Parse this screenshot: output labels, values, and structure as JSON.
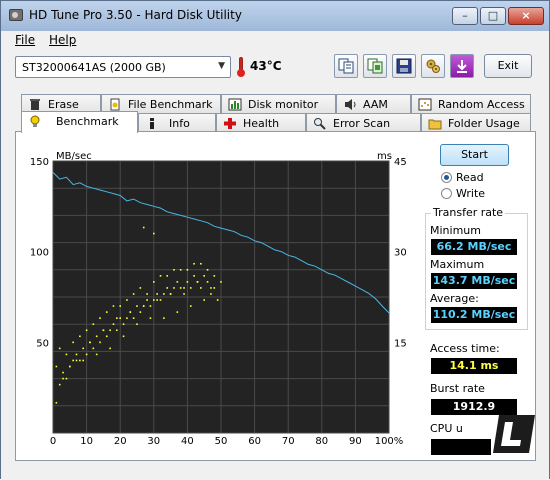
{
  "window": {
    "title": "HD Tune Pro 3.50 - Hard Disk Utility",
    "minimize_label": "–",
    "maximize_label": "□",
    "close_label": "×"
  },
  "menu": {
    "file": "File",
    "help": "Help"
  },
  "toolbar": {
    "drive": "ST32000641AS (2000 GB)",
    "temperature": "43°C",
    "exit_label": "Exit",
    "icons": [
      "copy-info-icon",
      "copy-screenshot-icon",
      "save-icon",
      "options-icon",
      "download-icon"
    ]
  },
  "tabs_row1": [
    "Erase",
    "File Benchmark",
    "Disk monitor",
    "AAM",
    "Random Access"
  ],
  "tabs_row2": [
    "Benchmark",
    "Info",
    "Health",
    "Error Scan",
    "Folder Usage"
  ],
  "active_tab": "Benchmark",
  "controls": {
    "start_label": "Start",
    "read_label": "Read",
    "write_label": "Write",
    "selected_mode": "Read"
  },
  "results": {
    "transfer_rate_title": "Transfer rate",
    "minimum_label": "Minimum",
    "minimum_value": "66.2 MB/sec",
    "maximum_label": "Maximum",
    "maximum_value": "143.7 MB/sec",
    "average_label": "Average:",
    "average_value": "110.2 MB/sec",
    "access_time_label": "Access time:",
    "access_time_value": "14.1 ms",
    "burst_rate_label": "Burst rate",
    "burst_rate_value": "1912.9 MB/sec",
    "cpu_label": "CPU u",
    "cpu_value": ""
  },
  "chart_data": {
    "type": "line",
    "left_axis_label": "MB/sec",
    "right_axis_label": "ms",
    "y_ticks_left": [
      "150",
      "100",
      "50"
    ],
    "y_ticks_right": [
      "45",
      "30",
      "15"
    ],
    "x_ticks": [
      "0",
      "10",
      "20",
      "30",
      "40",
      "50",
      "60",
      "70",
      "80",
      "90",
      "100%"
    ],
    "ylim_left": [
      0,
      150
    ],
    "ylim_right": [
      0,
      45
    ],
    "xlim": [
      0,
      100
    ],
    "colors": {
      "background": "#232323",
      "grid": "#4a4a4a",
      "transfer_line": "#48b7e8",
      "access_points": "#ffff33"
    },
    "series": [
      {
        "kind": "transfer",
        "x": [
          0,
          2,
          4,
          6,
          8,
          10,
          12,
          14,
          16,
          18,
          20,
          22,
          24,
          26,
          28,
          30,
          32,
          34,
          36,
          38,
          40,
          42,
          44,
          46,
          48,
          50,
          52,
          54,
          56,
          58,
          60,
          62,
          64,
          66,
          68,
          70,
          72,
          74,
          76,
          78,
          80,
          82,
          84,
          86,
          88,
          90,
          92,
          94,
          96,
          98,
          100
        ],
        "y": [
          143.7,
          140,
          141,
          137,
          138,
          136,
          135,
          134,
          133,
          132,
          131,
          128,
          129,
          127,
          126,
          125,
          124,
          122,
          121,
          120,
          119,
          118,
          117,
          116,
          114,
          113,
          112,
          111,
          109,
          108,
          106,
          105,
          103,
          101,
          100,
          98,
          97,
          95,
          93,
          92,
          90,
          88,
          87,
          85,
          83,
          81,
          79,
          77,
          74,
          70,
          66.2
        ]
      },
      {
        "kind": "access",
        "x": [
          1,
          2,
          3,
          4,
          5,
          6,
          7,
          8,
          9,
          10,
          11,
          12,
          13,
          14,
          15,
          16,
          17,
          18,
          19,
          20,
          21,
          22,
          23,
          24,
          25,
          26,
          27,
          28,
          29,
          30,
          31,
          32,
          33,
          34,
          35,
          36,
          37,
          38,
          39,
          40,
          41,
          42,
          43,
          44,
          45,
          46,
          47,
          48,
          49,
          50,
          2,
          4,
          6,
          8,
          10,
          12,
          14,
          16,
          18,
          20,
          22,
          24,
          26,
          28,
          30,
          32,
          34,
          36,
          38,
          40,
          42,
          44,
          46,
          48,
          3,
          7,
          11,
          15,
          19,
          23,
          27,
          31,
          35,
          39,
          43,
          47,
          1,
          5,
          9,
          13,
          17,
          21,
          25,
          29,
          33,
          37,
          41,
          45,
          30,
          27
        ],
        "y": [
          5,
          8,
          10,
          9,
          11,
          12,
          13,
          12,
          14,
          13,
          15,
          14,
          16,
          15,
          17,
          16,
          17,
          18,
          17,
          19,
          18,
          19,
          20,
          19,
          21,
          20,
          21,
          22,
          21,
          22,
          23,
          22,
          23,
          24,
          23,
          24,
          25,
          24,
          23,
          25,
          24,
          26,
          25,
          24,
          26,
          25,
          23,
          24,
          22,
          25,
          14,
          13,
          15,
          16,
          17,
          18,
          19,
          20,
          21,
          21,
          22,
          23,
          24,
          23,
          25,
          26,
          26,
          27,
          27,
          27,
          28,
          28,
          27,
          26,
          9,
          12,
          15,
          17,
          19,
          20,
          21,
          22,
          23,
          24,
          25,
          24,
          11,
          11,
          12,
          13,
          14,
          16,
          18,
          19,
          19,
          20,
          21,
          22,
          33,
          34
        ]
      }
    ]
  }
}
